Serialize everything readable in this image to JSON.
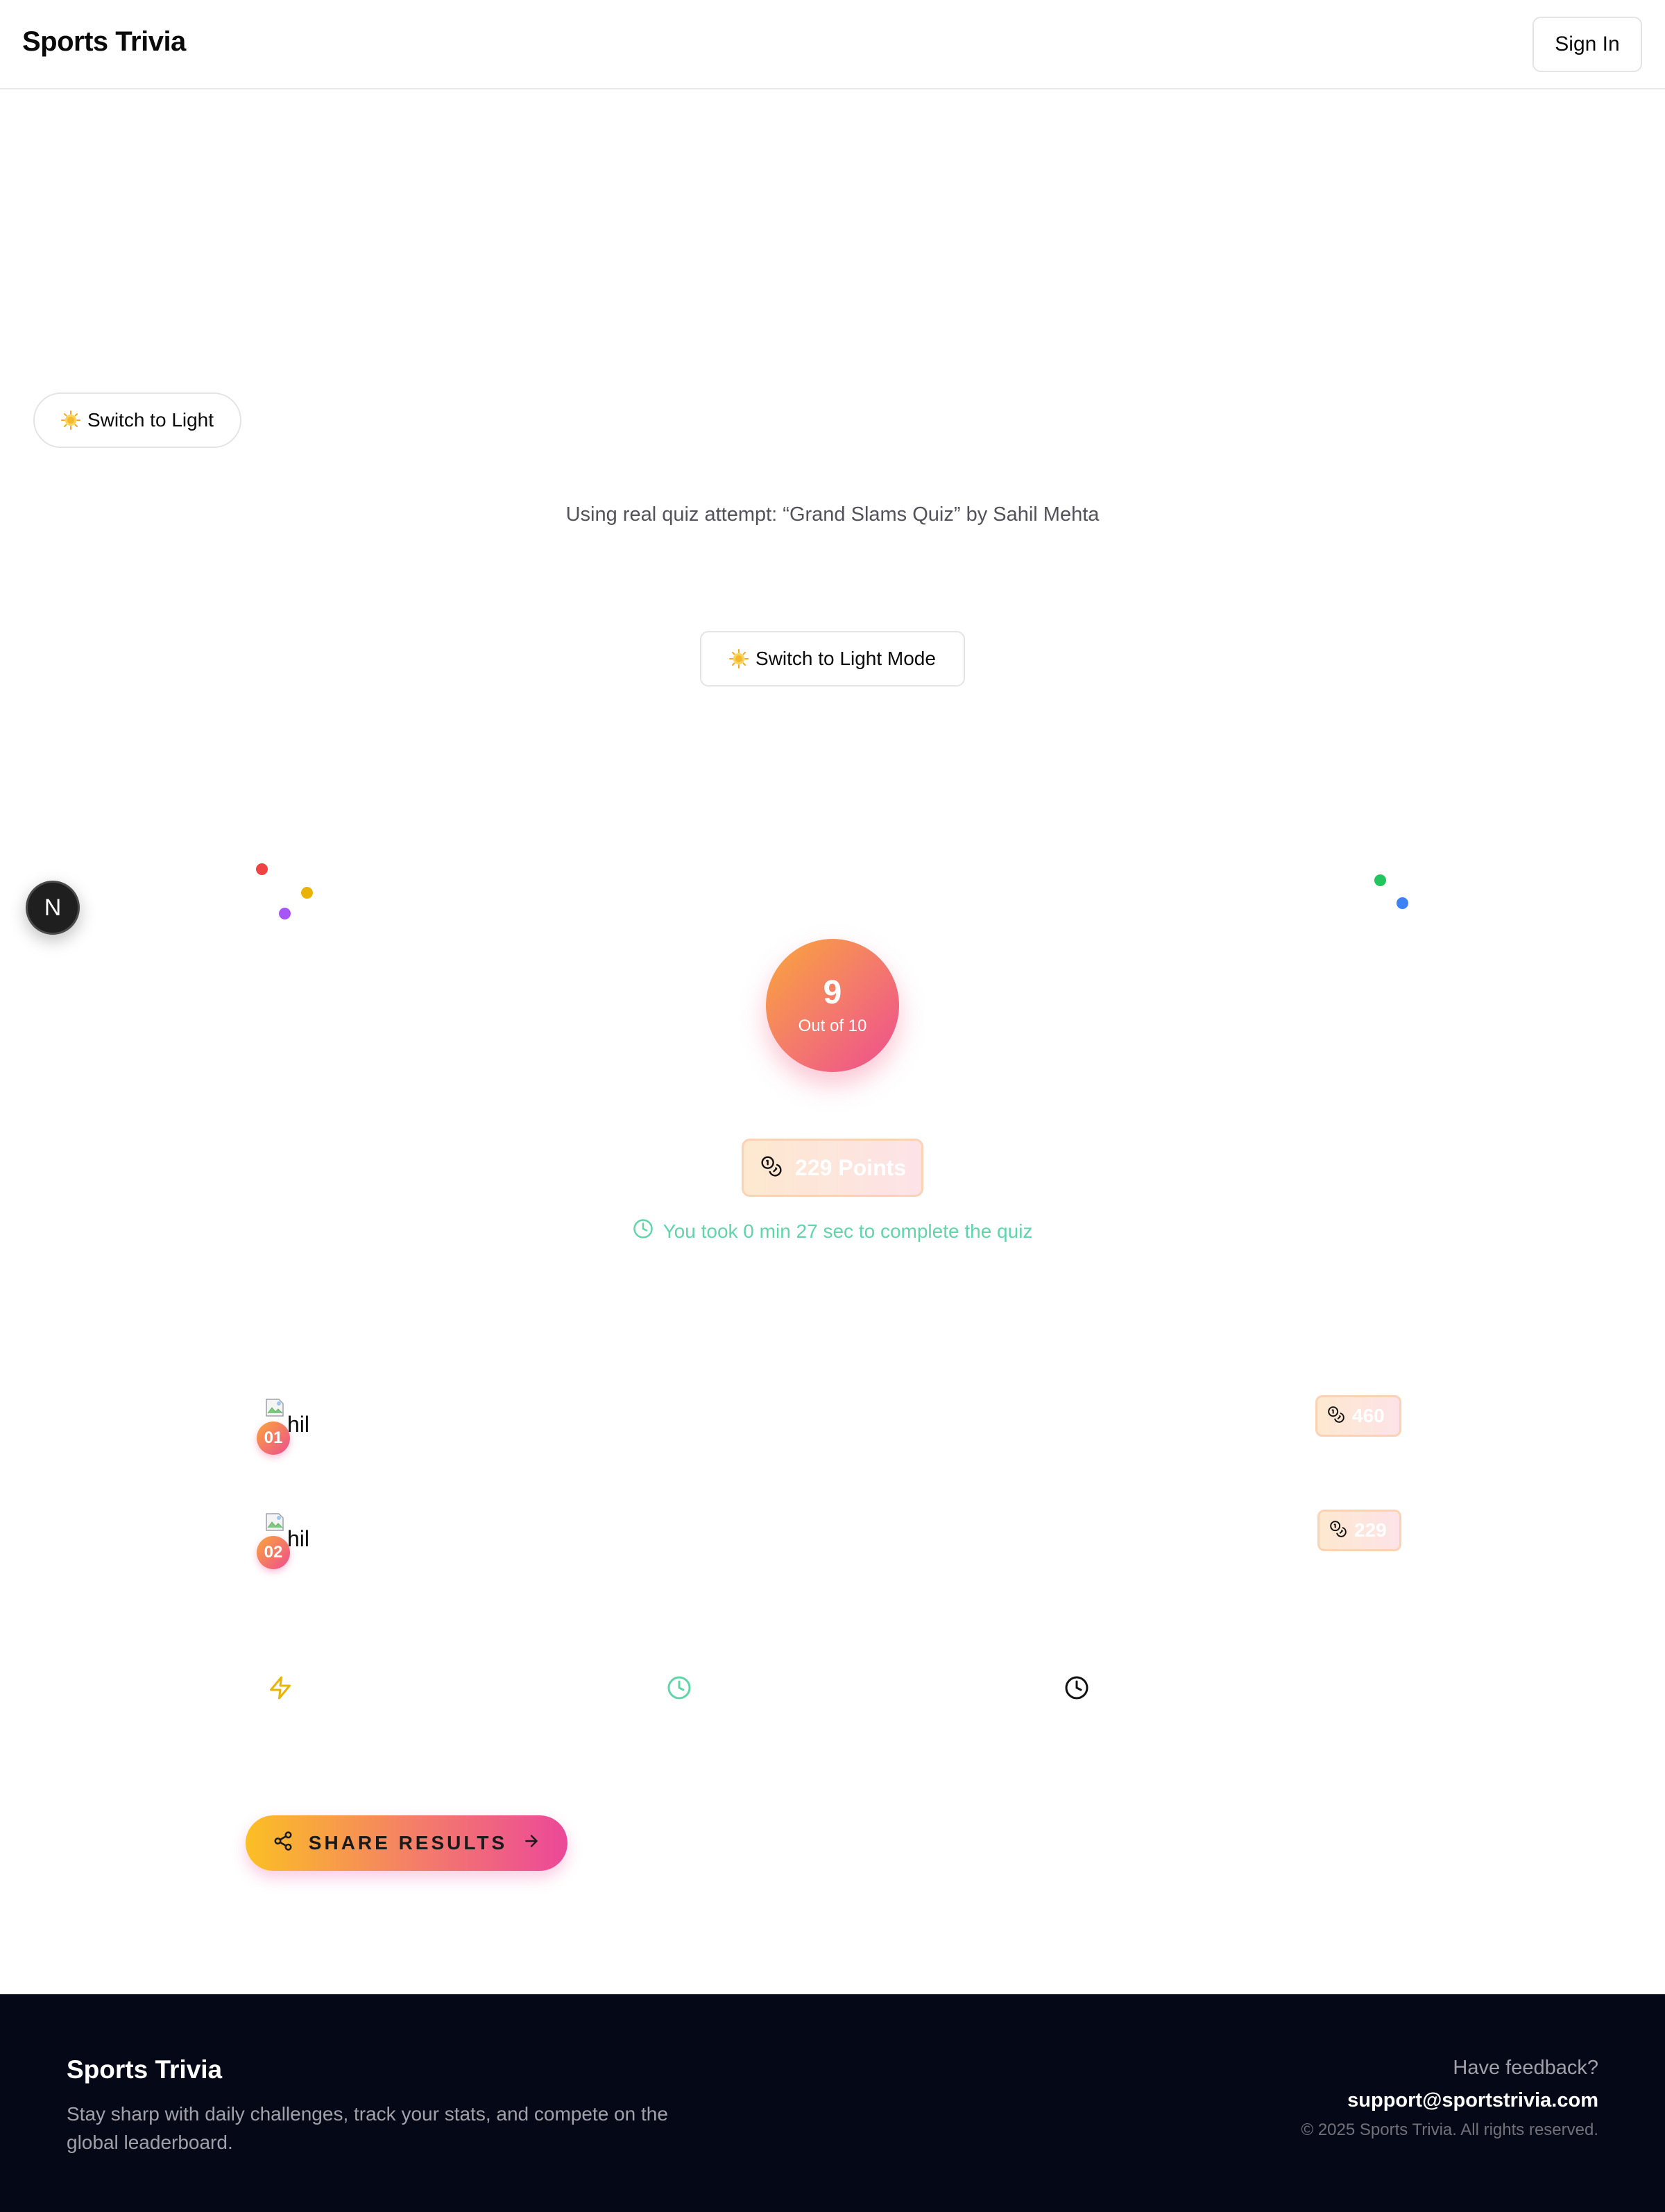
{
  "header": {
    "brand": "Sports Trivia",
    "sign_in_label": "Sign In"
  },
  "theme": {
    "pill_toggle_label": "Switch to Light",
    "rect_toggle_label": "Switch to Light Mode",
    "icon": "sun-icon"
  },
  "attempt_note": "Using real quiz attempt: “Grand Slams Quiz” by Sahil Mehta",
  "floating_button": {
    "label": "N"
  },
  "confetti_colors": [
    "#ef4444",
    "#eab308",
    "#a855f7",
    "#22c55e",
    "#3b82f6"
  ],
  "result": {
    "score": "9",
    "out_of": "Out of 10",
    "points": "229 Points",
    "time_note": "You took 0 min 27 sec to complete the quiz",
    "time_color": "#5fd6a8"
  },
  "leaderboard": [
    {
      "rank": "01",
      "name": "hil",
      "score": "460"
    },
    {
      "rank": "02",
      "name": "hil",
      "score": "229"
    }
  ],
  "stats_icons": [
    "lightning-icon",
    "clock-icon",
    "clock-icon"
  ],
  "share": {
    "label": "SHARE RESULTS"
  },
  "footer": {
    "brand": "Sports Trivia",
    "tagline": "Stay sharp with daily challenges, track your stats, and compete on the global leaderboard.",
    "feedback_question": "Have feedback?",
    "email": "support@sportstrivia.com",
    "copyright": "© 2025 Sports Trivia. All rights reserved."
  },
  "colors": {
    "accent_gradient_start": "#f9a63a",
    "accent_gradient_end": "#ee4d8f",
    "footer_bg": "#050816"
  }
}
